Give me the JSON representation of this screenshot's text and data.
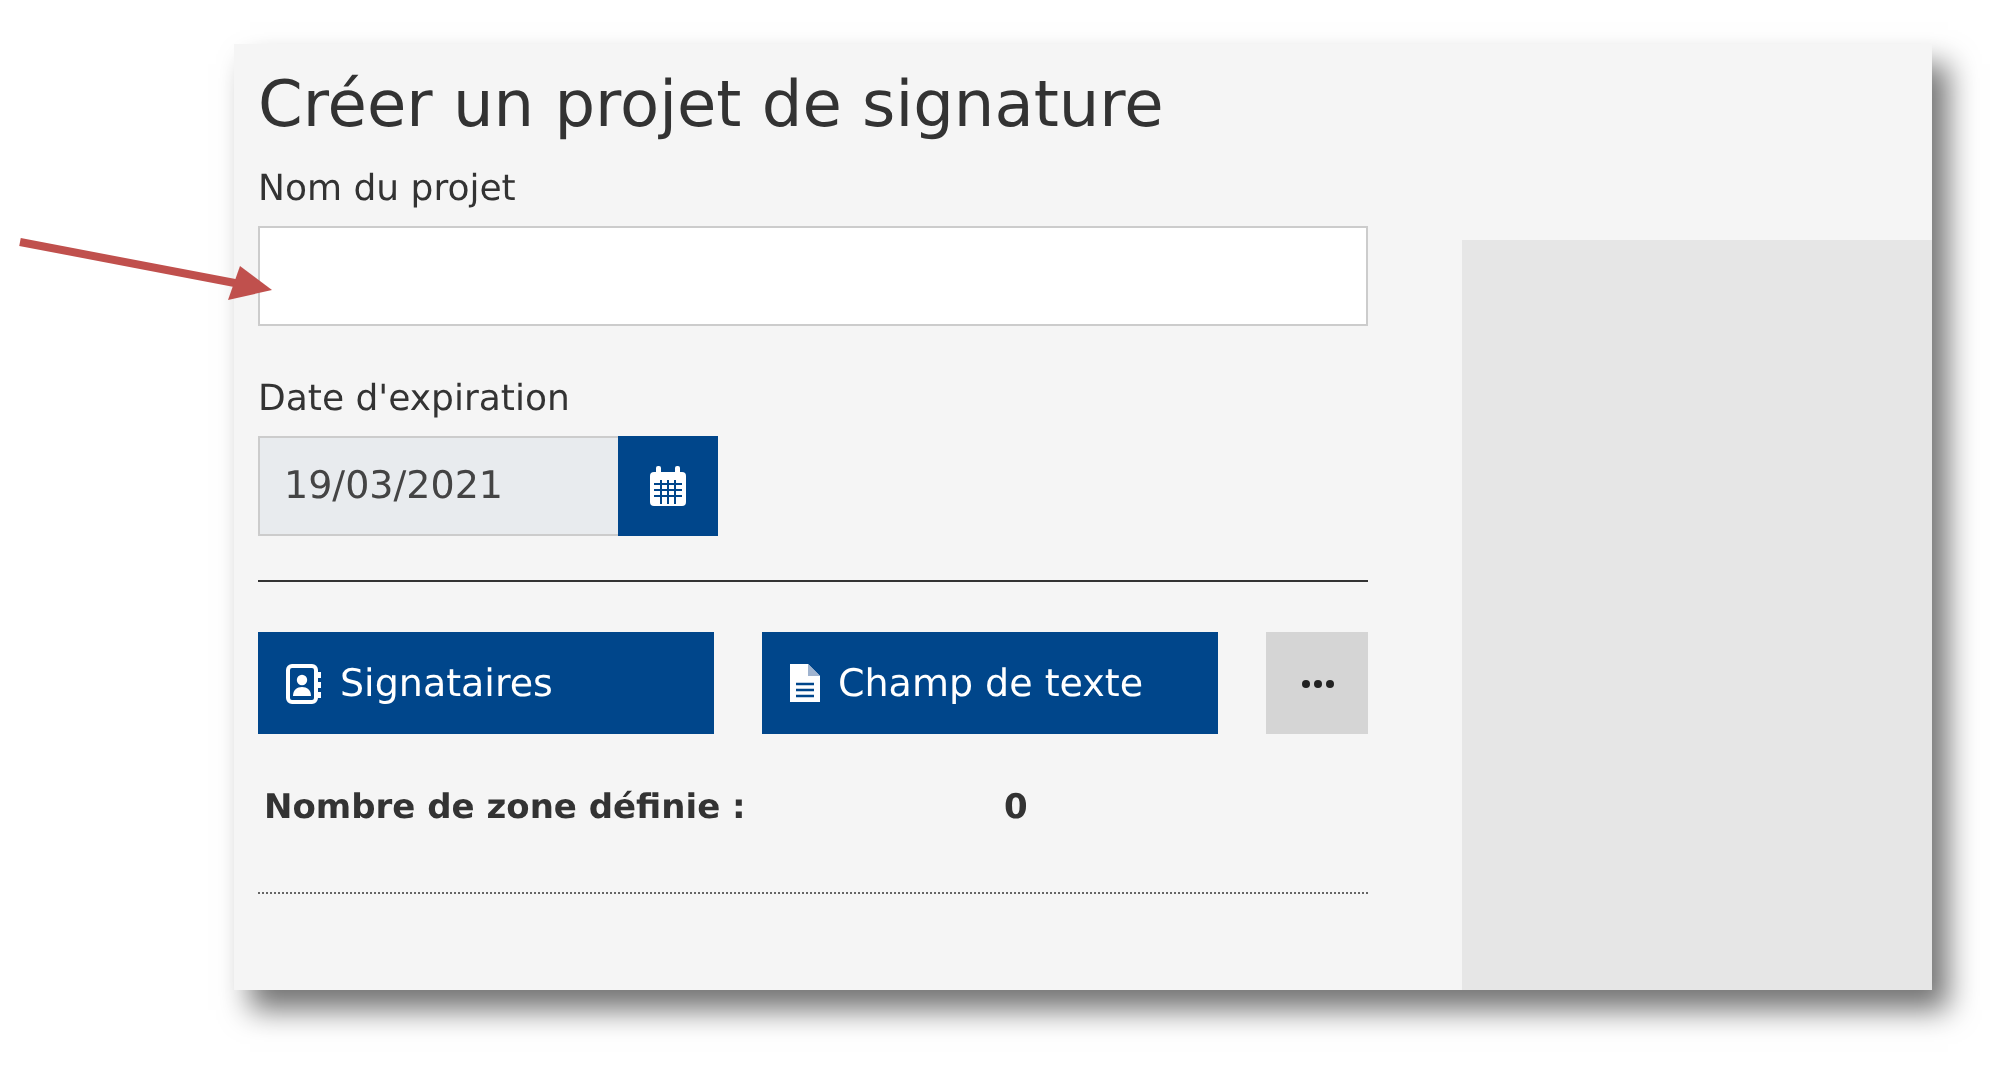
{
  "title": "Créer un projet de signature",
  "project_name": {
    "label": "Nom du projet"
  },
  "expiration": {
    "label": "Date d'expiration",
    "value": "19/03/2021"
  },
  "buttons": [
    {
      "kind": "signers",
      "label": "Signataires"
    },
    {
      "kind": "text-field",
      "label": "Champ de texte"
    },
    {
      "kind": "more"
    }
  ],
  "summary": {
    "label": "Nombre de zone définie :",
    "value": "0"
  }
}
